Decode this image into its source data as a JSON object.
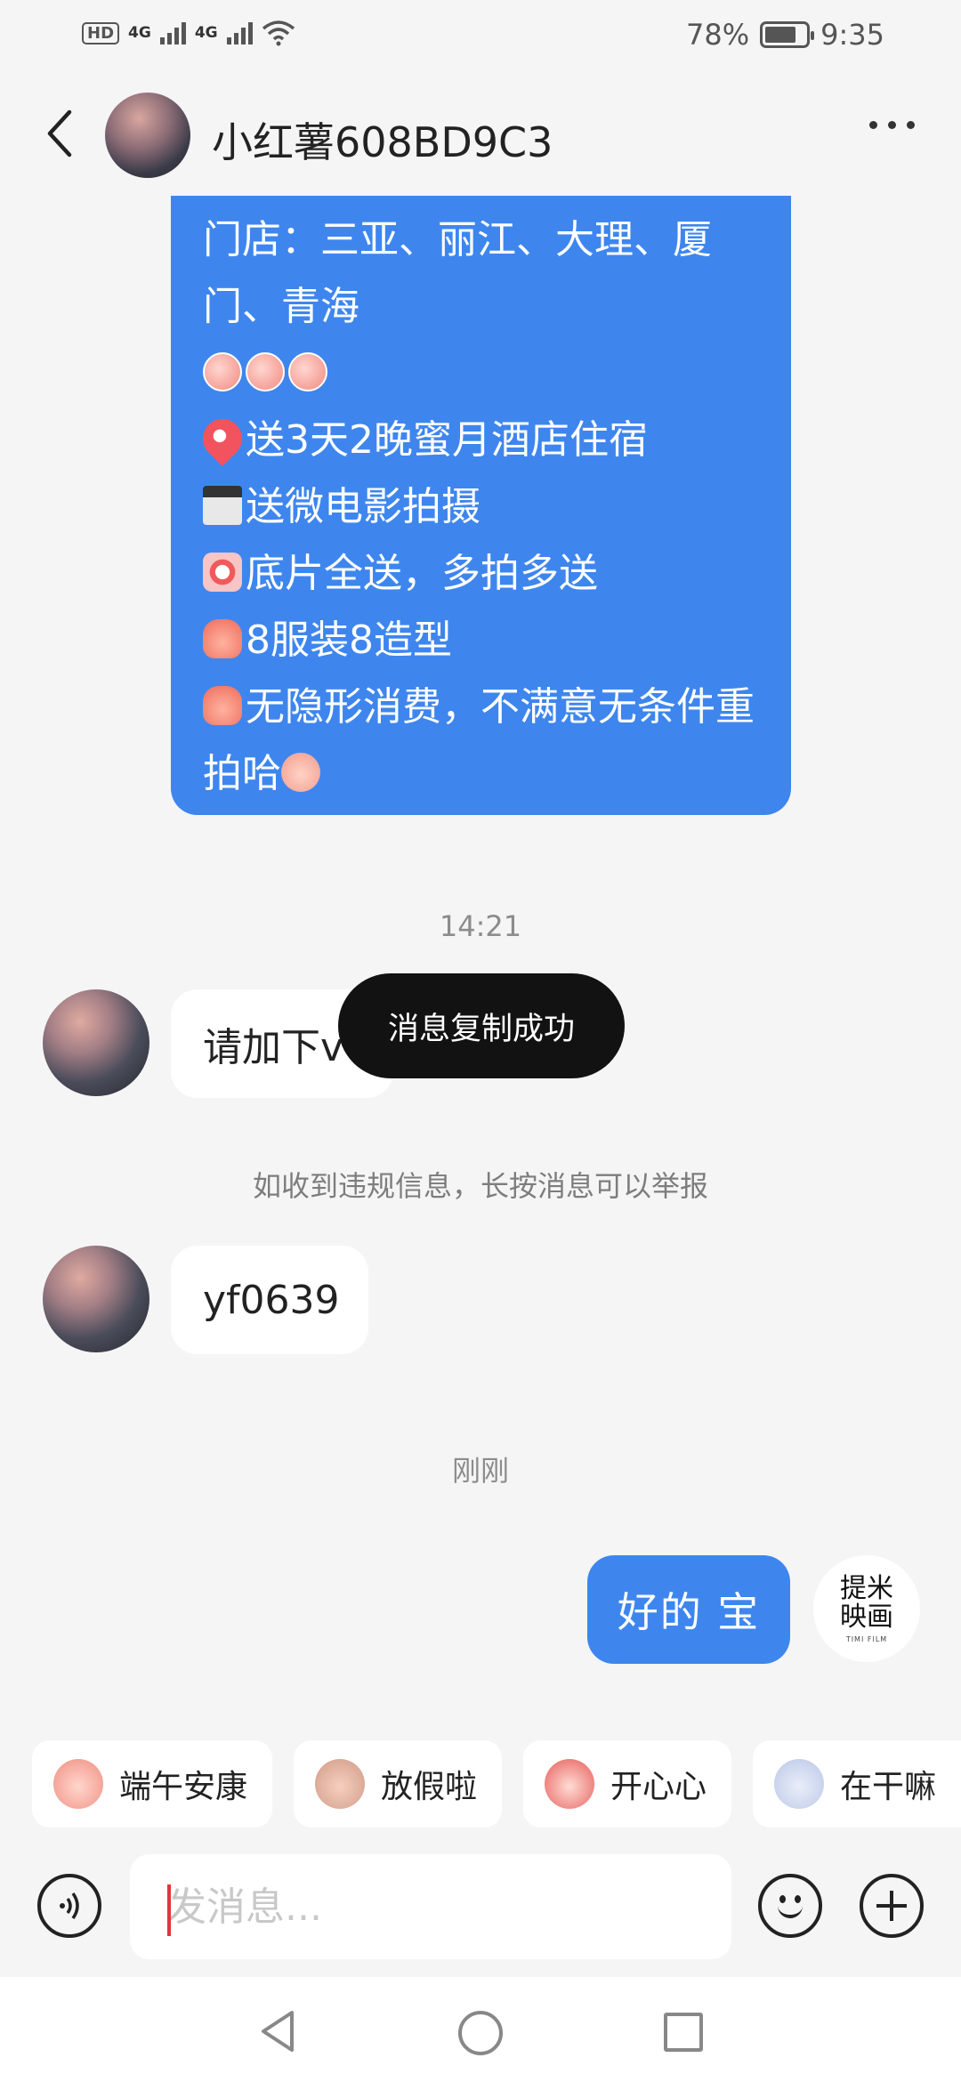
{
  "status_bar": {
    "hd": "HD",
    "sim1": "4G",
    "sim2": "4G",
    "battery_text": "78%",
    "battery_level": 0.78,
    "time": "9:35"
  },
  "header": {
    "title": "小红薯608BD9C3",
    "back_icon": "chevron-left-icon",
    "more_icon": "more-dots-icon"
  },
  "messages": {
    "incoming_big": {
      "lines": [
        "门店：三亚、丽江、大理、厦门、青海",
        "送3天2晚蜜月酒店住宿",
        "送微电影拍摄",
        "底片全送，多拍多送",
        "8服装8造型",
        "无隐形消费，不满意无条件重拍哈"
      ]
    },
    "time1": "14:21",
    "msg_add": "请加下v",
    "notice": "如收到违规信息，长按消息可以举报",
    "msg_id": "yf0639",
    "time2": "刚刚",
    "my_msg": "好的 宝"
  },
  "toast": "消息复制成功",
  "my_avatar": {
    "logo_text": "提米映画",
    "logo_sub": "TIMI FILM"
  },
  "quick_stickers": [
    {
      "label": "端午安康"
    },
    {
      "label": "放假啦"
    },
    {
      "label": "开心心"
    },
    {
      "label": "在干嘛"
    }
  ],
  "input": {
    "placeholder": "发消息..."
  },
  "colors": {
    "bubble_blue": "#3e86ee",
    "background": "#f5f5f6",
    "toast_bg": "#121212"
  }
}
